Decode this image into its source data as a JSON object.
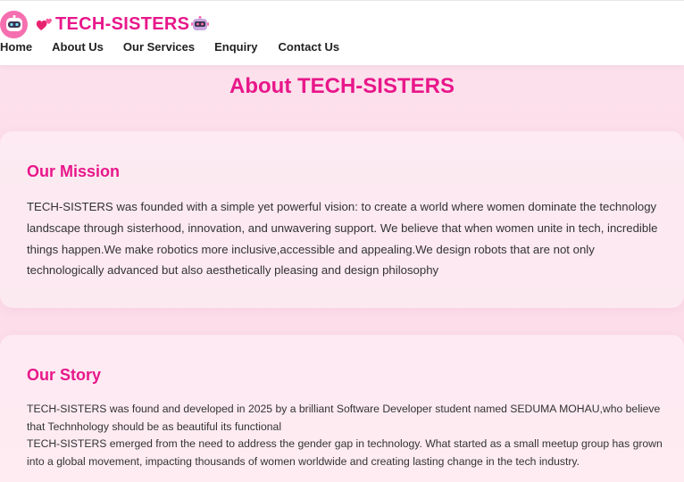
{
  "brand": {
    "name": "TECH-SISTERS"
  },
  "nav": {
    "items": [
      {
        "label": "Home"
      },
      {
        "label": "About Us"
      },
      {
        "label": "Our Services"
      },
      {
        "label": "Enquiry"
      },
      {
        "label": "Contact Us"
      }
    ]
  },
  "page": {
    "title": "About TECH-SISTERS"
  },
  "mission": {
    "heading": "Our Mission",
    "text": "TECH-SISTERS was founded with a simple yet powerful vision: to create a world where women dominate the technology landscape through sisterhood, innovation, and unwavering support. We believe that when women unite in tech, incredible things happen.We make robotics more inclusive,accessible and appealing.We design robots that are not only technologically advanced but also aesthetically pleasing and design philosophy"
  },
  "story": {
    "heading": "Our Story",
    "paragraph1": "TECH-SISTERS was found and developed in 2025 by a brilliant Software Developer student named SEDUMA MOHAU,who believe that Technhology should be as beautiful its functional",
    "paragraph2": "TECH-SISTERS emerged from the need to address the gender gap in technology. What started as a small meetup group has grown into a global movement, impacting thousands of women worldwide and creating lasting change in the tech industry."
  },
  "colors": {
    "accent": "#e8178a",
    "background": "#fde4ee",
    "logo_circle": "#f56fb0"
  },
  "icons": {
    "logo": "robot-face-icon",
    "hearts": "two-hearts-icon",
    "robot": "robot-icon"
  }
}
